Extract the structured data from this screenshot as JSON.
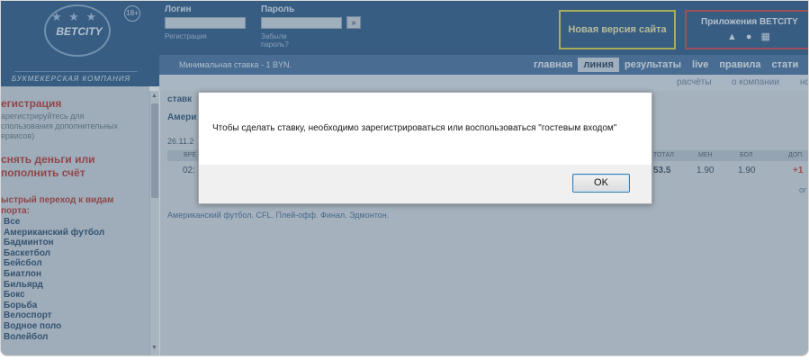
{
  "header": {
    "logo_text": "BETCITY",
    "age_badge": "18+",
    "logo_subtitle": "БУКМЕКЕРСКАЯ КОМПАНИЯ",
    "login_label": "Логин",
    "password_label": "Пароль",
    "register_link": "Регистрация",
    "forgot_link": "Забыли пароль?",
    "go_button": "»",
    "new_version": "Новая версия сайта",
    "apps_title": "Приложения BETCITY",
    "app_icons": [
      "android-icon",
      "apple-icon",
      "windows-icon"
    ]
  },
  "nav": {
    "min_bet": "Минимальная ставка - 1 BYN.",
    "links": [
      "главная",
      "линия",
      "результаты",
      "live",
      "правила",
      "стати"
    ],
    "active_index": 1,
    "sub_links": [
      "расчёты",
      "о компании",
      "нс"
    ]
  },
  "sidebar": {
    "register_title": "егистрация",
    "register_desc": [
      "арегистрируйтесь для",
      "спользования дополнительных",
      "ервисов)"
    ],
    "money_title": [
      "снять деньги или",
      "пополнить счёт"
    ],
    "quick_title": [
      "ыстрый переход к видам",
      "порта:"
    ],
    "sports": [
      "Все",
      "Американский футбол",
      "Бадминтон",
      "Баскетбол",
      "Бейсбол",
      "Биатлон",
      "Бильярд",
      "Бокс",
      "Борьба",
      "Велоспорт",
      "Водное поло",
      "Волейбол"
    ]
  },
  "main": {
    "crumb": "ставк",
    "section": "Амери",
    "date": "26.11.2",
    "time": "02:",
    "col_time": "ВРЕ",
    "cols": [
      "ТОТАЛ",
      "МЕН",
      "БОЛ",
      "ДОП"
    ],
    "values": [
      "53.5",
      "1.90",
      "1.90",
      "+1"
    ],
    "other": "ог",
    "footer": "Американский футбол. CFL. Плей-офф. Финал. Эдмонтон."
  },
  "dialog": {
    "message": "Чтобы сделать ставку, необходимо зарегистрироваться или воспользоваться \"гостевым входом\"",
    "ok_label": "OK"
  }
}
